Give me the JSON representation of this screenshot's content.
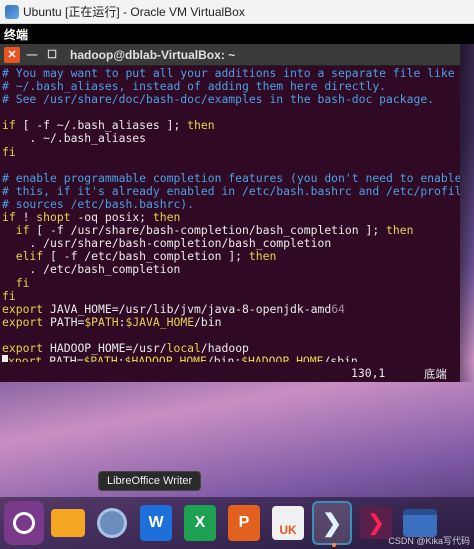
{
  "host_window": {
    "title": "Ubuntu [正在运行] - Oracle VM VirtualBox"
  },
  "ubuntu_topbar": {
    "app_name": "终端"
  },
  "terminal": {
    "title": "hadoop@dblab-VirtualBox: ~",
    "lines": [
      [
        {
          "t": "# You may want to put all your additions into a separate file like",
          "c": "comment"
        }
      ],
      [
        {
          "t": "# ~/.bash_aliases, instead of adding them here directly.",
          "c": "comment"
        }
      ],
      [
        {
          "t": "# See /usr/share/doc/bash-doc/examples in the bash-doc package.",
          "c": "comment"
        }
      ],
      [
        {
          "t": "",
          "c": "normal"
        }
      ],
      [
        {
          "t": "if",
          "c": "keyword"
        },
        {
          "t": " [ -f ~/.bash_aliases ]; ",
          "c": "normal"
        },
        {
          "t": "then",
          "c": "keyword"
        }
      ],
      [
        {
          "t": "    . ~/.bash_aliases",
          "c": "normal"
        }
      ],
      [
        {
          "t": "fi",
          "c": "keyword"
        }
      ],
      [
        {
          "t": "",
          "c": "normal"
        }
      ],
      [
        {
          "t": "# enable programmable completion features (you don't need to enable",
          "c": "comment"
        }
      ],
      [
        {
          "t": "# this, if it's already enabled in /etc/bash.bashrc and /etc/profile",
          "c": "comment"
        }
      ],
      [
        {
          "t": "# sources /etc/bash.bashrc).",
          "c": "comment"
        }
      ],
      [
        {
          "t": "if",
          "c": "keyword"
        },
        {
          "t": " ! ",
          "c": "normal"
        },
        {
          "t": "shopt",
          "c": "keyword"
        },
        {
          "t": " -oq posix; ",
          "c": "normal"
        },
        {
          "t": "then",
          "c": "keyword"
        }
      ],
      [
        {
          "t": "  ",
          "c": "normal"
        },
        {
          "t": "if",
          "c": "keyword"
        },
        {
          "t": " [ -f /usr/share/bash-completion/bash_completion ]; ",
          "c": "normal"
        },
        {
          "t": "then",
          "c": "keyword"
        }
      ],
      [
        {
          "t": "    . /usr/share/bash-completion/bash_completion",
          "c": "normal"
        }
      ],
      [
        {
          "t": "  ",
          "c": "normal"
        },
        {
          "t": "elif",
          "c": "keyword"
        },
        {
          "t": " [ -f /etc/bash_completion ]; ",
          "c": "normal"
        },
        {
          "t": "then",
          "c": "keyword"
        }
      ],
      [
        {
          "t": "    . /etc/bash_completion",
          "c": "normal"
        }
      ],
      [
        {
          "t": "  ",
          "c": "normal"
        },
        {
          "t": "fi",
          "c": "keyword"
        }
      ],
      [
        {
          "t": "fi",
          "c": "keyword"
        }
      ],
      [
        {
          "t": "export",
          "c": "keyword"
        },
        {
          "t": " JAVA_HOME",
          "c": "normal"
        },
        {
          "t": "=/usr/lib/jvm/java-8-openjdk-amd",
          "c": "normal"
        },
        {
          "t": "64",
          "c": "dim"
        }
      ],
      [
        {
          "t": "export",
          "c": "keyword"
        },
        {
          "t": " PATH",
          "c": "normal"
        },
        {
          "t": "=",
          "c": "normal"
        },
        {
          "t": "$PATH",
          "c": "keyword"
        },
        {
          "t": ":",
          "c": "normal"
        },
        {
          "t": "$JAVA_HOME",
          "c": "keyword"
        },
        {
          "t": "/bin",
          "c": "normal"
        }
      ],
      [
        {
          "t": "",
          "c": "normal"
        }
      ],
      [
        {
          "t": "export",
          "c": "keyword"
        },
        {
          "t": " HADOOP_HOME",
          "c": "normal"
        },
        {
          "t": "=/usr/",
          "c": "normal"
        },
        {
          "t": "local",
          "c": "keyword"
        },
        {
          "t": "/hadoop",
          "c": "normal"
        }
      ],
      [
        {
          "t": "cursor",
          "c": "cursor"
        },
        {
          "t": "xport",
          "c": "keyword"
        },
        {
          "t": " PATH",
          "c": "normal"
        },
        {
          "t": "=",
          "c": "normal"
        },
        {
          "t": "$PATH",
          "c": "keyword"
        },
        {
          "t": ":",
          "c": "normal"
        },
        {
          "t": "$HADOOP_HOME",
          "c": "keyword"
        },
        {
          "t": "/bin:",
          "c": "normal"
        },
        {
          "t": "$HADOOP_HOME",
          "c": "keyword"
        },
        {
          "t": "/sbin",
          "c": "normal"
        }
      ]
    ],
    "status": {
      "position": "130,1",
      "mode": "底端"
    }
  },
  "tooltip": {
    "text": "LibreOffice Writer"
  },
  "dock": {
    "items": [
      {
        "name": "ubuntu-dock-item",
        "icon": "ubuntu-logo-icon",
        "label": ""
      },
      {
        "name": "files-dock-item",
        "icon": "folder-icon",
        "label": ""
      },
      {
        "name": "browser-dock-item",
        "icon": "browser-icon",
        "label": ""
      },
      {
        "name": "writer-dock-item",
        "icon": "writer-icon",
        "label": "W"
      },
      {
        "name": "calc-dock-item",
        "icon": "calc-icon",
        "label": "X"
      },
      {
        "name": "impress-dock-item",
        "icon": "impress-icon",
        "label": "P"
      },
      {
        "name": "software-dock-item",
        "icon": "software-store-icon",
        "label": "UK"
      },
      {
        "name": "terminal-dock-item-active",
        "icon": "terminal-chevron-icon",
        "label": "❯"
      },
      {
        "name": "terminal-dock-item-2",
        "icon": "terminal-chevron-icon",
        "label": "❯"
      },
      {
        "name": "apps-dock-item",
        "icon": "app-window-icon",
        "label": ""
      }
    ]
  },
  "watermark": "CSDN @Kika写代码",
  "colors": {
    "terminal_bg": "#300a24",
    "comment": "#4aa0e6",
    "keyword": "#e6d44a",
    "text": "#ececec"
  }
}
